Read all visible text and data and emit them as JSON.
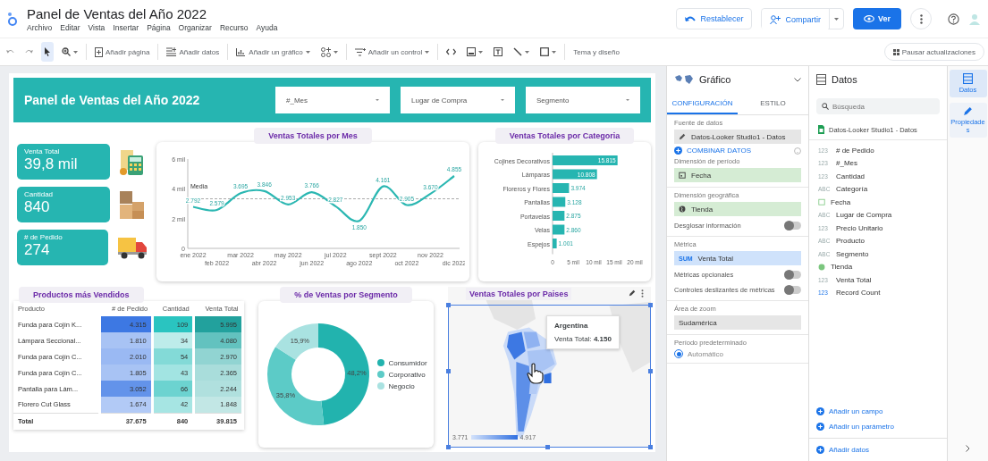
{
  "app": {
    "title": "Panel de Ventas del Año 2022",
    "menu": [
      "Archivo",
      "Editar",
      "Vista",
      "Insertar",
      "Página",
      "Organizar",
      "Recurso",
      "Ayuda"
    ]
  },
  "header_actions": {
    "reset": "Restablecer",
    "share": "Compartir",
    "view": "Ver"
  },
  "toolbar": {
    "add_page": "Añadir página",
    "add_data": "Añadir datos",
    "add_chart": "Añadir un gráfico",
    "add_control": "Añadir un control",
    "theme": "Tema y diseño",
    "pause": "Pausar actualizaciones"
  },
  "report": {
    "title": "Panel de Ventas del Año 2022",
    "filters": [
      "#_Mes",
      "Lugar de Compra",
      "Segmento"
    ],
    "kpis": [
      {
        "label": "Venta Total",
        "value": "39,8 mil",
        "kind": "calculator"
      },
      {
        "label": "Cantidad",
        "value": "840",
        "kind": "boxes"
      },
      {
        "label": "# de Pedido",
        "value": "274",
        "kind": "truck"
      }
    ],
    "line_chart": {
      "title": "Ventas Totales por Mes",
      "chart_data": {
        "type": "line",
        "categories": [
          "ene 2022",
          "feb 2022",
          "mar 2022",
          "abr 2022",
          "may 2022",
          "jun 2022",
          "jul 2022",
          "ago 2022",
          "sept 2022",
          "oct 2022",
          "nov 2022",
          "dic 2022"
        ],
        "series": [
          {
            "color": "#2bb7b2",
            "values": [
              2.79,
              2.58,
              3.7,
              3.85,
              2.95,
              3.77,
              2.83,
              1.85,
              4.16,
              2.91,
              3.67,
              4.86
            ]
          }
        ],
        "value_labels": [
          "2.792",
          "2.579",
          "3.695",
          "3.846",
          "2.953",
          "3.766",
          "2.827",
          "1.850",
          "4.161",
          "2.905",
          "3.670",
          "4.855"
        ],
        "ylim": [
          0,
          6
        ],
        "yticks": [
          {
            "value": 0,
            "label": "0"
          },
          {
            "value": 2,
            "label": "2 mil"
          },
          {
            "value": 4,
            "label": "4 mil"
          },
          {
            "value": 6,
            "label": "6 mil"
          }
        ],
        "ref_lines": [
          {
            "axis": "y",
            "value": 3.33,
            "label": "Media"
          }
        ]
      }
    },
    "bar_chart": {
      "title": "Ventas Totales por Categoria",
      "chart_data": {
        "type": "bar",
        "orientation": "horizontal",
        "categories": [
          "Cojines Decorativos",
          "Lámparas",
          "Floreros y Flores",
          "Pantallas",
          "Portavelas",
          "Velas",
          "Espejos"
        ],
        "series": [
          {
            "color": "#26b5b1",
            "values": [
              15.8,
              10.8,
              4,
              3.1,
              2.9,
              2.9,
              1
            ]
          }
        ],
        "value_labels": [
          "15.815",
          "10.808",
          "3.974",
          "3.128",
          "2.875",
          "2.860",
          "1.001"
        ],
        "xlim": [
          0,
          20
        ],
        "xticks": [
          {
            "value": 0,
            "label": "0"
          },
          {
            "value": 5,
            "label": "5 mil"
          },
          {
            "value": 10,
            "label": "10 mil"
          },
          {
            "value": 15,
            "label": "15 mil"
          },
          {
            "value": 20,
            "label": "20 mil"
          }
        ]
      }
    },
    "table": {
      "title": "Productos más Vendidos",
      "columns": [
        "Producto",
        "# de Pedido",
        "Cantidad",
        "Venta Total"
      ],
      "rows": [
        {
          "cells": [
            {
              "text": "Funda para Cojín K..."
            },
            {
              "text": "4.315",
              "color": "#3d78e3"
            },
            {
              "text": "109",
              "color": "#2ac4c0"
            },
            {
              "text": "5.995",
              "color": "#22a19d"
            }
          ]
        },
        {
          "cells": [
            {
              "text": "Lámpara Seccional..."
            },
            {
              "text": "1.810",
              "color": "#a8c3f4"
            },
            {
              "text": "34",
              "color": "#bdecea"
            },
            {
              "text": "4.080",
              "color": "#63c2bf"
            }
          ]
        },
        {
          "cells": [
            {
              "text": "Funda para Cojín C..."
            },
            {
              "text": "2.010",
              "color": "#9ab9f3"
            },
            {
              "text": "54",
              "color": "#83dad7"
            },
            {
              "text": "2.970",
              "color": "#91d4d2"
            }
          ]
        },
        {
          "cells": [
            {
              "text": "Funda para Cojín C..."
            },
            {
              "text": "1.805",
              "color": "#a8c3f4"
            },
            {
              "text": "43",
              "color": "#a2e4e2"
            },
            {
              "text": "2.365",
              "color": "#a9dddb"
            }
          ]
        },
        {
          "cells": [
            {
              "text": "Pantalla para Lám..."
            },
            {
              "text": "3.052",
              "color": "#6393ea"
            },
            {
              "text": "66",
              "color": "#6cd3d0"
            },
            {
              "text": "2.244",
              "color": "#b0e0de"
            }
          ]
        },
        {
          "cells": [
            {
              "text": "Florero Cut Glass"
            },
            {
              "text": "1.674",
              "color": "#b2caf6"
            },
            {
              "text": "42",
              "color": "#a6e5e3"
            },
            {
              "text": "1.848",
              "color": "#c2e7e5"
            }
          ]
        }
      ],
      "total": [
        "Total",
        "37.675",
        "840",
        "39.815"
      ]
    },
    "donut": {
      "title": "% de Ventas por Segmento",
      "chart_data": {
        "type": "donut",
        "categories": [
          "Consumidor",
          "Corporativo",
          "Negocio"
        ],
        "series": [
          {
            "values": [
              48.2,
              35.8,
              15.9
            ]
          }
        ],
        "colors": [
          "#22b3ae",
          "#5ccbc7",
          "#a9e2e1"
        ],
        "value_labels": [
          "48,2%",
          "35,8%",
          "15,9%"
        ]
      }
    },
    "map": {
      "kind": "picture",
      "title": "Ventas Totales por Paises",
      "tooltip": {
        "title": "Argentina",
        "value": "Venta Total: **4.150**"
      },
      "legend": [
        "3.771",
        "4.917"
      ]
    }
  },
  "properties_panel": {
    "title": "Gráfico",
    "tabs": [
      {
        "label": "CONFIGURACIÓN",
        "selected": true
      },
      {
        "label": "ESTILO",
        "selected": false
      }
    ],
    "sections": [
      [
        {
          "kind": "label",
          "text": "Fuente de datos"
        },
        {
          "kind": "source",
          "text": "Datos-Looker Studio1 - Datos"
        },
        {
          "kind": "action",
          "text": "COMBINAR DATOS"
        },
        {
          "kind": "label",
          "text": "Dimensión de período"
        },
        {
          "kind": "date",
          "text": "Fecha"
        }
      ],
      [
        {
          "kind": "label",
          "text": "Dimensión geográfica"
        },
        {
          "kind": "geo",
          "text": "Tienda"
        },
        {
          "kind": "toggle",
          "text": "Desglosar información",
          "on": false
        }
      ],
      [
        {
          "kind": "label",
          "text": "Métrica"
        },
        {
          "kind": "metric",
          "badge": "SUM",
          "text": "Venta Total"
        },
        {
          "kind": "toggle",
          "text": "Métricas opcionales",
          "on": false
        },
        {
          "kind": "toggle",
          "text": "Controles deslizantes de métricas",
          "on": false
        }
      ],
      [
        {
          "kind": "label",
          "text": "Área de zoom"
        },
        {
          "kind": "select",
          "text": "Sudamérica"
        }
      ],
      [
        {
          "kind": "label",
          "text": "Período predeterminado"
        },
        {
          "kind": "radio",
          "text": "Automático",
          "selected": true
        }
      ]
    ]
  },
  "data_panel": {
    "title": "Datos",
    "search": {
      "placeholder": "Búsqueda"
    },
    "source": "Datos-Looker Studio1 - Datos",
    "fields": [
      {
        "kind": "number",
        "badge": "123",
        "name": "# de Pedido"
      },
      {
        "kind": "number",
        "badge": "123",
        "name": "#_Mes"
      },
      {
        "kind": "number",
        "badge": "123",
        "name": "Cantidad"
      },
      {
        "kind": "text",
        "badge": "ABC",
        "name": "Categoría"
      },
      {
        "kind": "date",
        "name": "Fecha"
      },
      {
        "kind": "text",
        "badge": "ABC",
        "name": "Lugar de Compra"
      },
      {
        "kind": "number",
        "badge": "123",
        "name": "Precio Unitario"
      },
      {
        "kind": "text",
        "badge": "ABC",
        "name": "Producto"
      },
      {
        "kind": "text",
        "badge": "ABC",
        "name": "Segmento"
      },
      {
        "kind": "geo",
        "name": "Tienda"
      },
      {
        "kind": "number",
        "badge": "123",
        "name": "Venta Total"
      },
      {
        "kind": "calc",
        "badge": "123",
        "name": "Record Count"
      }
    ],
    "actions": [
      "Añadir un campo",
      "Añadir un parámetro"
    ],
    "footer": "Añadir datos"
  },
  "rail": [
    {
      "kind": "data",
      "label": "Datos",
      "selected": true
    },
    {
      "kind": "properties",
      "label": "Propiedades",
      "selected": false
    }
  ]
}
